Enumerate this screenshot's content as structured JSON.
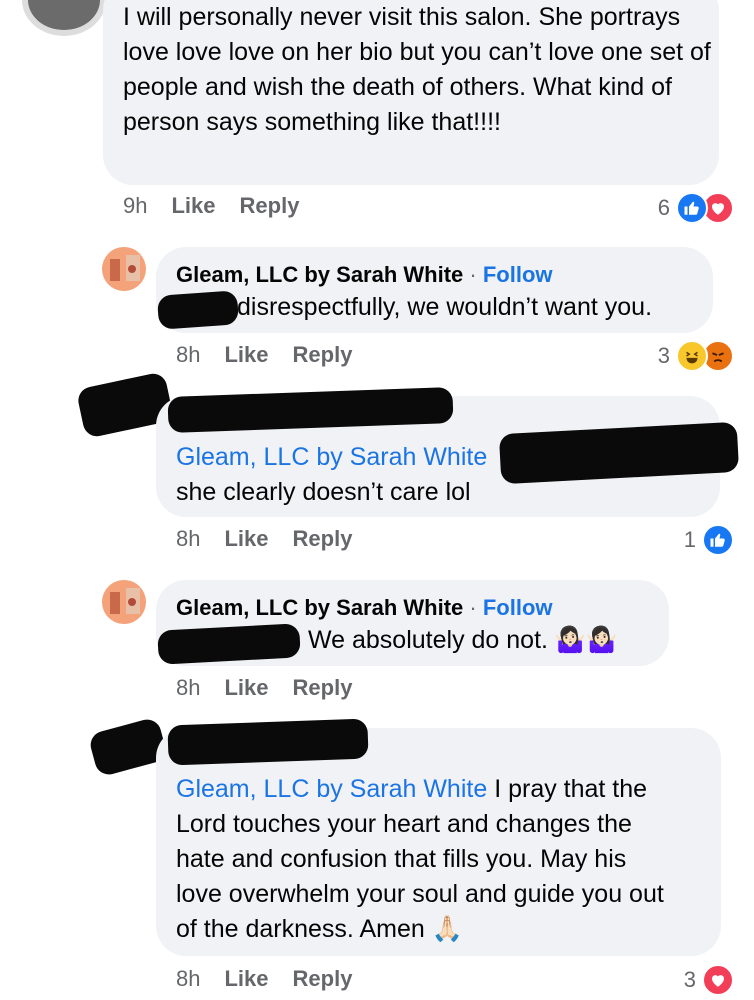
{
  "comments": [
    {
      "text": "I will personally never visit this salon. She portrays love love love on her bio but you can’t love one set of people and wish the death of others. What kind of person says something like that!!!!",
      "time": "9h",
      "like": "Like",
      "reply": "Reply",
      "reaction_count": "6",
      "reactions": [
        "like-icon",
        "love-icon"
      ]
    },
    {
      "author": "Gleam, LLC by Sarah White",
      "sep": " · ",
      "follow": "Follow",
      "text": "disrespectfully, we wouldn’t want you.",
      "time": "8h",
      "like": "Like",
      "reply": "Reply",
      "reaction_count": "3",
      "reactions": [
        "haha-icon",
        "angry-icon"
      ]
    },
    {
      "mention": "Gleam, LLC by Sarah White",
      "text": "she clearly doesn’t care lol",
      "time": "8h",
      "like": "Like",
      "reply": "Reply",
      "reaction_count": "1",
      "reactions": [
        "like-icon"
      ]
    },
    {
      "author": "Gleam, LLC by Sarah White",
      "sep": " · ",
      "follow": "Follow",
      "text": "We absolutely do not. 🤷🏻‍♀️🤷🏻‍♀️",
      "time": "8h",
      "like": "Like",
      "reply": "Reply"
    },
    {
      "mention": "Gleam, LLC by Sarah White",
      "text_lines": [
        " I pray that the",
        "Lord touches your heart and changes the",
        "hate and confusion that fills you. May his",
        "love overwhelm your soul and guide you out",
        "of the darkness. Amen 🙏🏻"
      ],
      "time": "8h",
      "like": "Like",
      "reply": "Reply",
      "reaction_count": "3",
      "reactions": [
        "love-icon"
      ]
    }
  ],
  "colors": {
    "bubble": "#f0f2f5",
    "link": "#1b74e4",
    "meta": "#65676b",
    "like_blue": "#1877f2",
    "love_red": "#f33e58"
  }
}
